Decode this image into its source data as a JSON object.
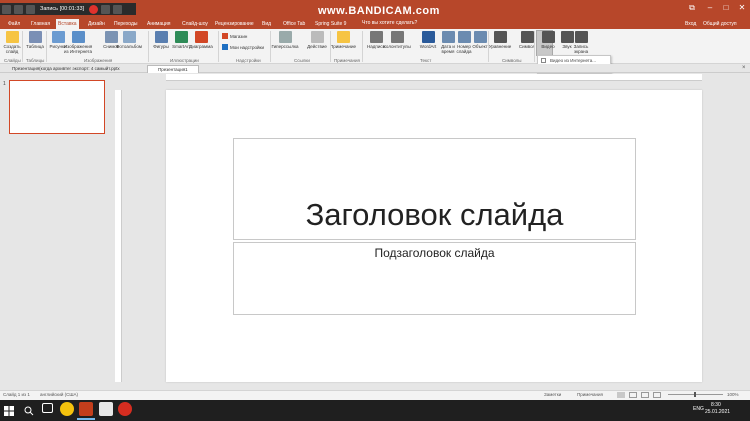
{
  "recorder": {
    "label": "Запись [00:01:33]"
  },
  "watermark": "www.BANDICAM.com",
  "title_search": "Что вы хотите сделать?",
  "menu": {
    "tabs": [
      "Файл",
      "Главная",
      "Вставка",
      "Дизайн",
      "Переходы",
      "Анимация",
      "Слайд-шоу",
      "Рецензирование",
      "Вид",
      "Office Tab",
      "Spring Suite 9"
    ],
    "active": "Вставка",
    "login": "Вход",
    "share": "Общий доступ"
  },
  "ribbon": {
    "buttons": [
      {
        "label": "Создать слайд",
        "icon": "new-slide-icon"
      },
      {
        "label": "Таблица",
        "icon": "table-icon"
      },
      {
        "label": "Рисунки",
        "icon": "pictures-icon"
      },
      {
        "label": "Изображения из Интернета",
        "icon": "online-pictures-icon"
      },
      {
        "label": "Снимок",
        "icon": "screenshot-icon"
      },
      {
        "label": "Фотоальбом",
        "icon": "photo-album-icon"
      },
      {
        "label": "Фигуры",
        "icon": "shapes-icon"
      },
      {
        "label": "SmartArt",
        "icon": "smartart-icon"
      },
      {
        "label": "Диаграмма",
        "icon": "chart-icon"
      },
      {
        "label": "Магазин",
        "icon": "store-icon"
      },
      {
        "label": "Мои надстройки",
        "icon": "my-addins-icon"
      },
      {
        "label": "Гиперссылка",
        "icon": "hyperlink-icon"
      },
      {
        "label": "Действие",
        "icon": "action-icon"
      },
      {
        "label": "Примечание",
        "icon": "comment-icon"
      },
      {
        "label": "Надпись",
        "icon": "textbox-icon"
      },
      {
        "label": "Колонтитулы",
        "icon": "header-footer-icon"
      },
      {
        "label": "WordArt",
        "icon": "wordart-icon"
      },
      {
        "label": "Дата и время",
        "icon": "datetime-icon"
      },
      {
        "label": "Номер слайда",
        "icon": "slide-number-icon"
      },
      {
        "label": "Объект",
        "icon": "object-icon"
      },
      {
        "label": "Уравнение",
        "icon": "equation-icon"
      },
      {
        "label": "Символ",
        "icon": "symbol-icon"
      },
      {
        "label": "Видео",
        "icon": "video-icon"
      },
      {
        "label": "Звук",
        "icon": "audio-icon"
      },
      {
        "label": "Запись экрана",
        "icon": "screen-recording-icon"
      }
    ],
    "groups": [
      "Слайды",
      "Таблицы",
      "Изображения",
      "Иллюстрации",
      "Надстройки",
      "Ссылки",
      "Примечания",
      "Текст",
      "Символы"
    ]
  },
  "dropdown": {
    "items": [
      "Видео из Интернета...",
      "Видео на компьютере..."
    ]
  },
  "doc_tabs": [
    {
      "label": "Презентация(когда архивтег экспорт: 4 самыйт.pptx",
      "active": false
    },
    {
      "label": "Презентация1",
      "active": true
    }
  ],
  "thumbnail": {
    "number": "1"
  },
  "slide": {
    "title": "Заголовок слайда",
    "subtitle": "Подзаголовок слайда"
  },
  "status": {
    "slide_info": "Слайд 1 из 1",
    "language": "английский (США)",
    "notes": "Заметки",
    "comments": "Примечания",
    "zoom": "100%"
  },
  "taskbar": {
    "lang": "ENG",
    "time": "8:30",
    "date": "25.01.2021"
  },
  "colors": {
    "accent": "#b7472a",
    "thumb_border": "#d24726"
  }
}
